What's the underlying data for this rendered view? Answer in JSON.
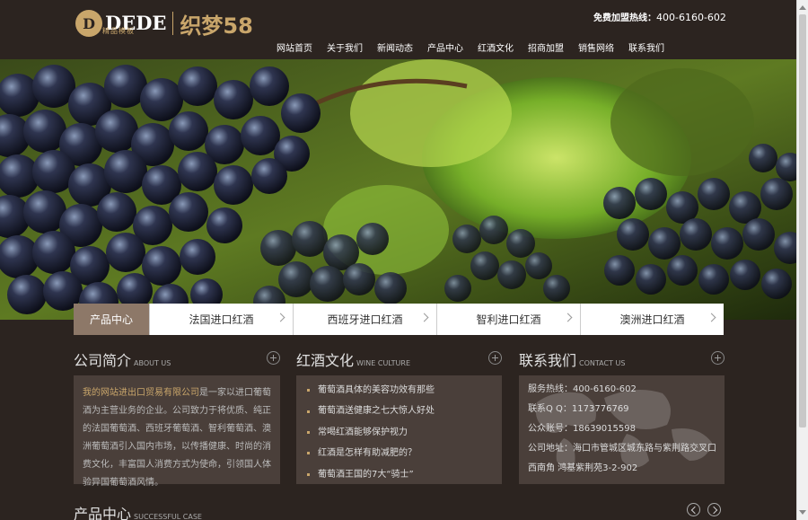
{
  "header": {
    "logo_letter": "D",
    "logo_dede": "DEDE",
    "logo_sub": "精品模板",
    "logo_brand": "织梦58",
    "hotline_label": "免费加盟热线：",
    "hotline_number": "400-6160-602"
  },
  "nav": {
    "items": [
      "网站首页",
      "关于我们",
      "新闻动态",
      "产品中心",
      "红酒文化",
      "招商加盟",
      "销售网络",
      "联系我们"
    ]
  },
  "category_bar": {
    "active": "产品中心",
    "items": [
      "法国进口红酒",
      "西班牙进口红酒",
      "智利进口红酒",
      "澳洲进口红酒"
    ]
  },
  "about": {
    "title": "公司简介",
    "subtitle": "ABOUT US",
    "company": "我的网站进出口贸易有限公司",
    "text": "是一家以进口葡萄酒为主营业务的企业。公司致力于将优质、纯正的法国葡萄酒、西班牙葡萄酒、智利葡萄酒、澳洲葡萄酒引入国内市场，以传播健康、时尚的消费文化，丰富国人消费方式为使命，引领国人体验异国葡萄酒风情。"
  },
  "culture": {
    "title": "红酒文化",
    "subtitle": "WINE CULTURE",
    "items": [
      "葡萄酒具体的美容功效有那些",
      "葡萄酒送健康之七大惊人好处",
      "常喝红酒能够保护视力",
      "红酒是怎样有助减肥的？",
      "葡萄酒王国的7大“骑士”"
    ]
  },
  "contact": {
    "title": "联系我们",
    "subtitle": "CONTACT US",
    "lines": [
      "服务热线：400-6160-602",
      "联系Q Q：1173776769",
      "公众账号：18639015598",
      "公司地址：海口市管城区城东路与紫荆路交叉口",
      "西南角 鸿基紫荆苑3-2-902"
    ]
  },
  "products": {
    "title": "产品中心",
    "subtitle": "SUCCESSFUL CASE"
  }
}
